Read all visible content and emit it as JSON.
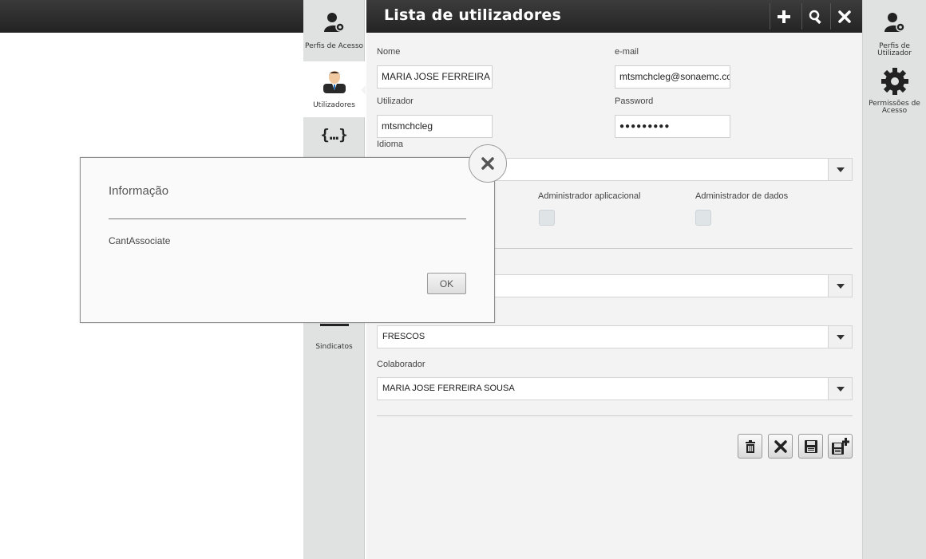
{
  "left_nav": {
    "items": [
      {
        "label": "Perfis de Acesso",
        "icon": "user-gear-icon"
      },
      {
        "label": "Utilizadores",
        "icon": "user-avatar-icon"
      },
      {
        "label": "",
        "icon": "braces-icon"
      },
      {
        "label": "Sindicatos",
        "icon": "table-icon"
      }
    ]
  },
  "panel": {
    "title": "Lista de utilizadores",
    "header_buttons": [
      "add-icon",
      "search-icon",
      "close-icon"
    ]
  },
  "form": {
    "nome_label": "Nome",
    "nome_value": "MARIA JOSE FERREIRA SOUSA",
    "email_label": "e-mail",
    "email_value": "mtsmchcleg@sonaemc.com",
    "utilizador_label": "Utilizador",
    "utilizador_value": "mtsmchcleg",
    "password_label": "Password",
    "password_value": "●●●●●●●●●",
    "idioma_label": "Idioma",
    "idioma_value": "",
    "admin_app_label": "Administrador aplicacional",
    "admin_dados_label": "Administrador de dados",
    "select2_value": "",
    "select3_value": "FRESCOS",
    "colaborador_label": "Colaborador",
    "colaborador_value": "MARIA JOSE FERREIRA SOUSA"
  },
  "right_nav": {
    "items": [
      {
        "label": "Perfis de Utilizador",
        "icon": "user-gear-icon"
      },
      {
        "label": "Permissões de Acesso",
        "icon": "gear-icon"
      }
    ]
  },
  "dialog": {
    "title": "Informação",
    "message": "CantAssociate",
    "ok_label": "OK"
  },
  "colors": {
    "header_bg": "#2b2b2b",
    "column_bg": "#dfe2e1",
    "panel_bg": "#f3f3f3"
  }
}
